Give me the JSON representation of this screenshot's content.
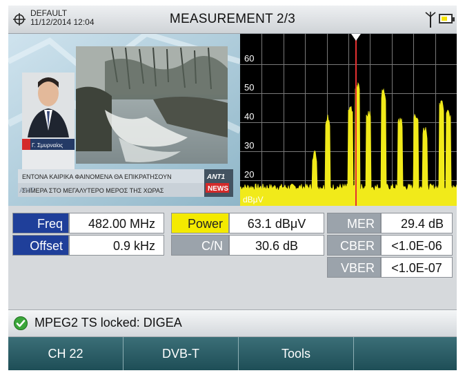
{
  "header": {
    "profile": "DEFAULT",
    "datetime": "11/12/2014 12:04",
    "title": "MEASUREMENT 2/3"
  },
  "video": {
    "ticker_line1": "ΕΝΤΟΝΑ ΚΑΙΡΙΚΑ ΦΑΙΝΟΜΕΝΑ ΘΑ ΕΠΙΚΡΑΤΗΣΟΥΝ",
    "ticker_line2": "ΣΗΜΕΡΑ ΣΤΟ ΜΕΓΑΛΥΤΕΡΟ ΜΕΡΟΣ ΤΗΣ ΧΩΡΑΣ",
    "channel_logo": "ANT1",
    "news_label": "NEWS",
    "ticker_prefix": "ANT",
    "nameplate": "Γ. Σμυρναίος"
  },
  "spectrum": {
    "y_ticks": [
      "60",
      "50",
      "40",
      "30",
      "20"
    ],
    "unit": "dBμV",
    "marker_color": "#e53030",
    "trace_color": "#f1ea1a"
  },
  "measurements": {
    "freq_label": "Freq",
    "freq_value": "482.00 MHz",
    "power_label": "Power",
    "power_value": "63.1 dBμV",
    "mer_label": "MER",
    "mer_value": "29.4 dB",
    "offset_label": "Offset",
    "offset_value": "0.9 kHz",
    "cn_label": "C/N",
    "cn_value": "30.6 dB",
    "cber_label": "CBER",
    "cber_value": "<1.0E-06",
    "vber_label": "VBER",
    "vber_value": "<1.0E-07"
  },
  "status": {
    "text": "MPEG2 TS locked: DIGEA",
    "icon": "check-circle-icon"
  },
  "softkeys": [
    "CH 22",
    "DVB-T",
    "Tools",
    ""
  ]
}
